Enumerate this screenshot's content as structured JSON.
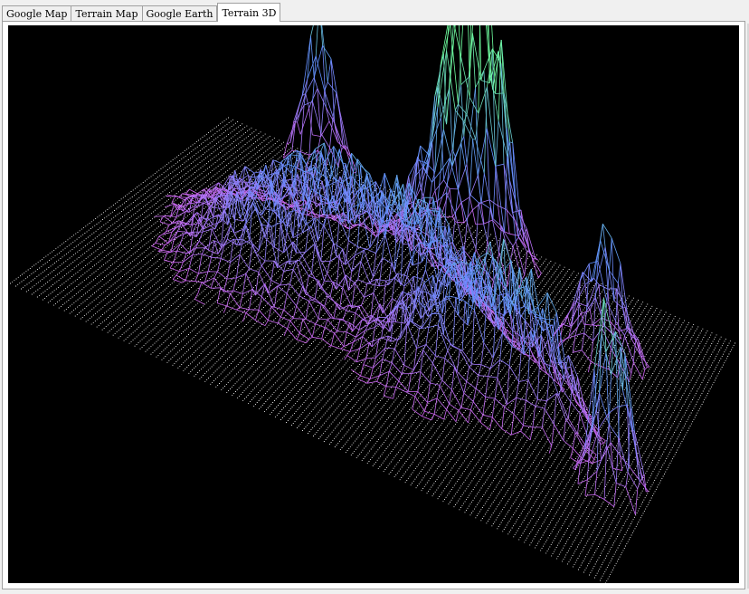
{
  "tabs": [
    {
      "label": "Google Map",
      "active": false
    },
    {
      "label": "Terrain Map",
      "active": false
    },
    {
      "label": "Google Earth",
      "active": false
    },
    {
      "label": "Terrain 3D",
      "active": true
    }
  ],
  "view": {
    "background": "#000000",
    "grid_dot_color": "#ffffff",
    "low_color": "#e060f0",
    "mid_color": "#6090ff",
    "high_color": "#70ffa0",
    "icon": "terrain-wireframe"
  }
}
